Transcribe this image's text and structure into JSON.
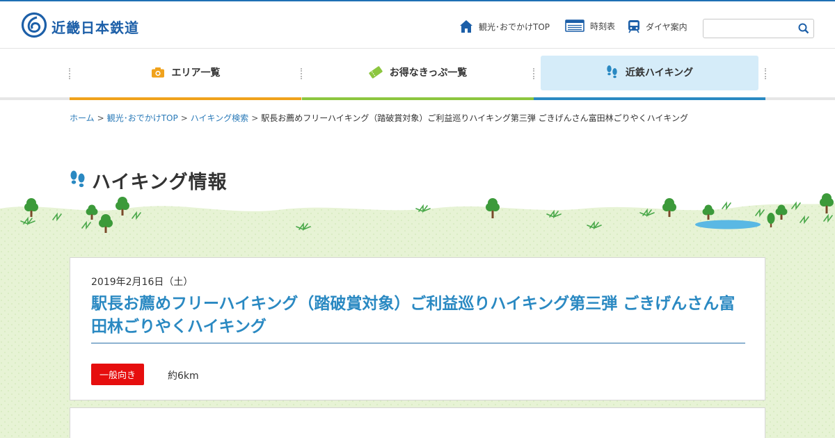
{
  "header": {
    "logo_text": "近畿日本鉄道",
    "nav": [
      {
        "label": "観光･おでかけTOP",
        "icon": "home-icon"
      },
      {
        "label": "時刻表",
        "icon": "timetable-icon"
      },
      {
        "label": "ダイヤ案内",
        "icon": "train-icon"
      }
    ],
    "search": {
      "placeholder": "",
      "value": ""
    }
  },
  "gnav": {
    "tabs": [
      {
        "label": "エリア一覧",
        "icon": "camera-icon",
        "color": "#f0a21c"
      },
      {
        "label": "お得なきっぷ一覧",
        "icon": "ticket-icon",
        "color": "#8cc63f"
      },
      {
        "label": "近鉄ハイキング",
        "icon": "footprint-icon",
        "color": "#2a89c2",
        "active": true
      }
    ]
  },
  "breadcrumb": {
    "items": [
      "ホーム",
      "観光･おでかけTOP",
      "ハイキング検索"
    ],
    "current": "駅長お薦めフリーハイキング（踏破賞対象）ご利益巡りハイキング第三弾 ごきげんさん富田林ごりやくハイキング",
    "separator": ">"
  },
  "page": {
    "heading": "ハイキング情報",
    "heading_icon": "footprint-icon"
  },
  "event": {
    "date": "2019年2月16日（土）",
    "title": "駅長お薦めフリーハイキング（踏破賞対象）ご利益巡りハイキング第三弾 ごきげんさん富田林ごりやくハイキング",
    "level": "一般向き",
    "distance": "約6km"
  },
  "colors": {
    "brand": "#1c5fa8",
    "link": "#2a7ab8",
    "title": "#2a89c2",
    "badge": "#e60e0e",
    "grass": "#e6f2d3"
  }
}
